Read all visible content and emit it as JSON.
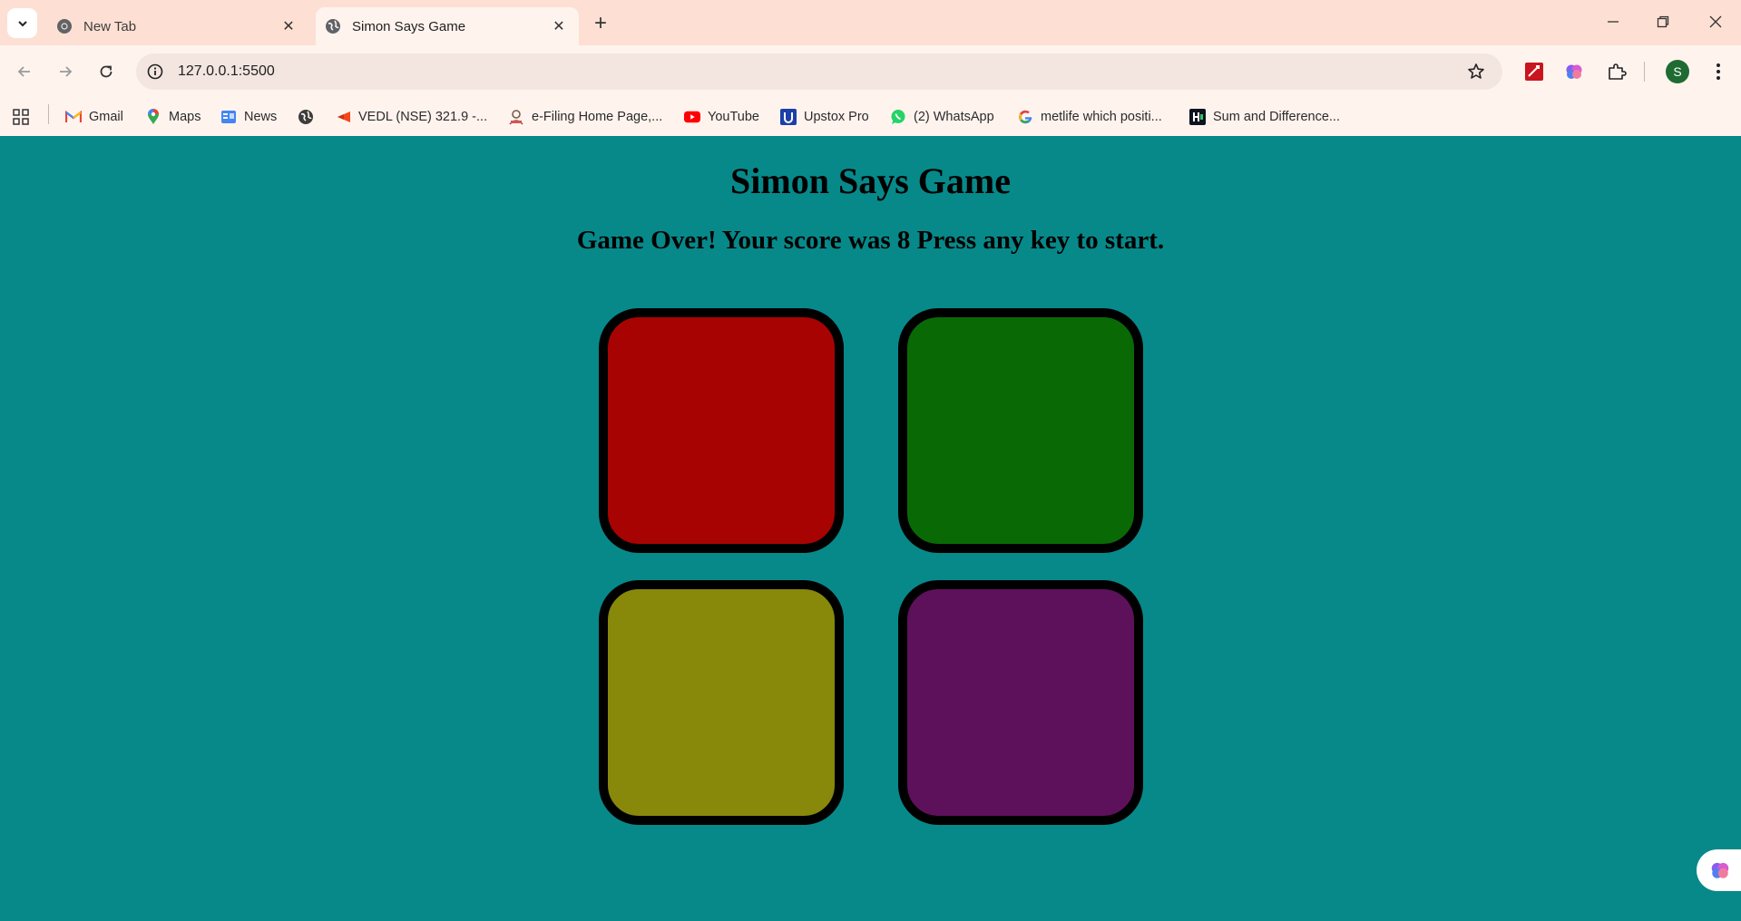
{
  "browser": {
    "tabs": [
      {
        "title": "New Tab",
        "active": false
      },
      {
        "title": "Simon Says Game",
        "active": true
      }
    ],
    "url": "127.0.0.1:5500",
    "bookmarks": [
      {
        "label": "Gmail",
        "icon": "gmail-icon"
      },
      {
        "label": "Maps",
        "icon": "maps-icon"
      },
      {
        "label": "News",
        "icon": "news-icon"
      },
      {
        "label": "",
        "icon": "globe-icon"
      },
      {
        "label": "VEDL (NSE) 321.9 -...",
        "icon": "kite-icon"
      },
      {
        "label": "e-Filing Home Page,...",
        "icon": "efiling-icon"
      },
      {
        "label": "YouTube",
        "icon": "youtube-icon"
      },
      {
        "label": "Upstox Pro",
        "icon": "upstox-icon"
      },
      {
        "label": "(2) WhatsApp",
        "icon": "whatsapp-icon"
      },
      {
        "label": "metlife which positi...",
        "icon": "google-icon"
      },
      {
        "label": "Sum and Difference...",
        "icon": "hackerrank-icon"
      }
    ],
    "profile_initial": "S"
  },
  "game": {
    "title": "Simon Says Game",
    "status": "Game Over! Your score was 8 Press any key to start.",
    "buttons": [
      {
        "name": "red",
        "color": "#a80303"
      },
      {
        "name": "green",
        "color": "#096a05"
      },
      {
        "name": "yellow",
        "color": "#88880b"
      },
      {
        "name": "purple",
        "color": "#5e115b"
      }
    ]
  },
  "colors": {
    "page_background": "#07898a",
    "tabstrip": "#fde0d3",
    "toolbar": "#fff3ee"
  }
}
